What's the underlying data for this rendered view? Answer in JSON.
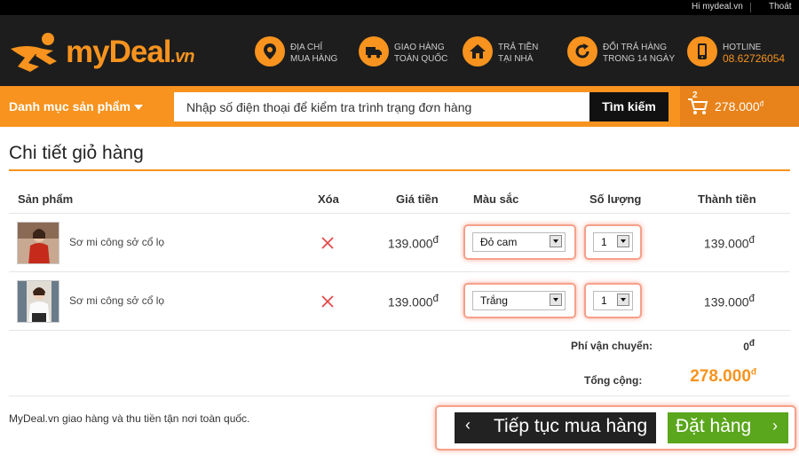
{
  "topbar": {
    "greeting": "Hi mydeal.vn",
    "logout": "Thoát"
  },
  "logo": {
    "text_my": "my",
    "text_deal": "Deal",
    "text_vn": ".vn"
  },
  "features": [
    {
      "icon": "location-pin-icon",
      "line1": "ĐỊA CHỈ",
      "line2": "MUA HÀNG"
    },
    {
      "icon": "truck-icon",
      "line1": "GIAO HÀNG",
      "line2": "TOÀN QUỐC"
    },
    {
      "icon": "home-icon",
      "line1": "TRẢ TIỀN",
      "line2": "TẠI NHÀ"
    },
    {
      "icon": "refresh-icon",
      "line1": "ĐỔI TRẢ HÀNG",
      "line2": "TRONG 14 NGÀY"
    },
    {
      "icon": "phone-icon",
      "line1": "HOTLINE",
      "line2": "08.62726054"
    }
  ],
  "nav": {
    "category_label": "Danh mục sản phẩm",
    "search_placeholder": "Nhập số điện thoại để kiểm tra trình trạng đơn hàng",
    "search_button": "Tìm kiếm",
    "cart_count": "2",
    "cart_total": "278.000",
    "currency": "đ"
  },
  "page_title": "Chi tiết giỏ hàng",
  "table": {
    "headers": [
      "Sản phẩm",
      "Xóa",
      "Giá tiền",
      "Màu sắc",
      "Số lượng",
      "Thành tiền"
    ],
    "rows": [
      {
        "name": "Sơ mi công sở cổ lọ",
        "price": "139.000",
        "color": "Đỏ cam",
        "qty": "1",
        "total": "139.000"
      },
      {
        "name": "Sơ mi công sở cổ lọ",
        "price": "139.000",
        "color": "Trắng",
        "qty": "1",
        "total": "139.000"
      }
    ]
  },
  "summary": {
    "shipping_label": "Phí vận chuyển:",
    "shipping_value": "0",
    "total_label": "Tổng cộng:",
    "total_value": "278.000"
  },
  "footer_note": "MyDeal.vn giao hàng và thu tiền tận nơi toàn quốc.",
  "buttons": {
    "continue": "Tiếp tục mua hàng",
    "order": "Đặt hàng"
  },
  "colors": {
    "accent": "#f7931e",
    "dark": "#1d1d1d",
    "order_green": "#5aa61c",
    "highlight": "#f6a08a"
  }
}
